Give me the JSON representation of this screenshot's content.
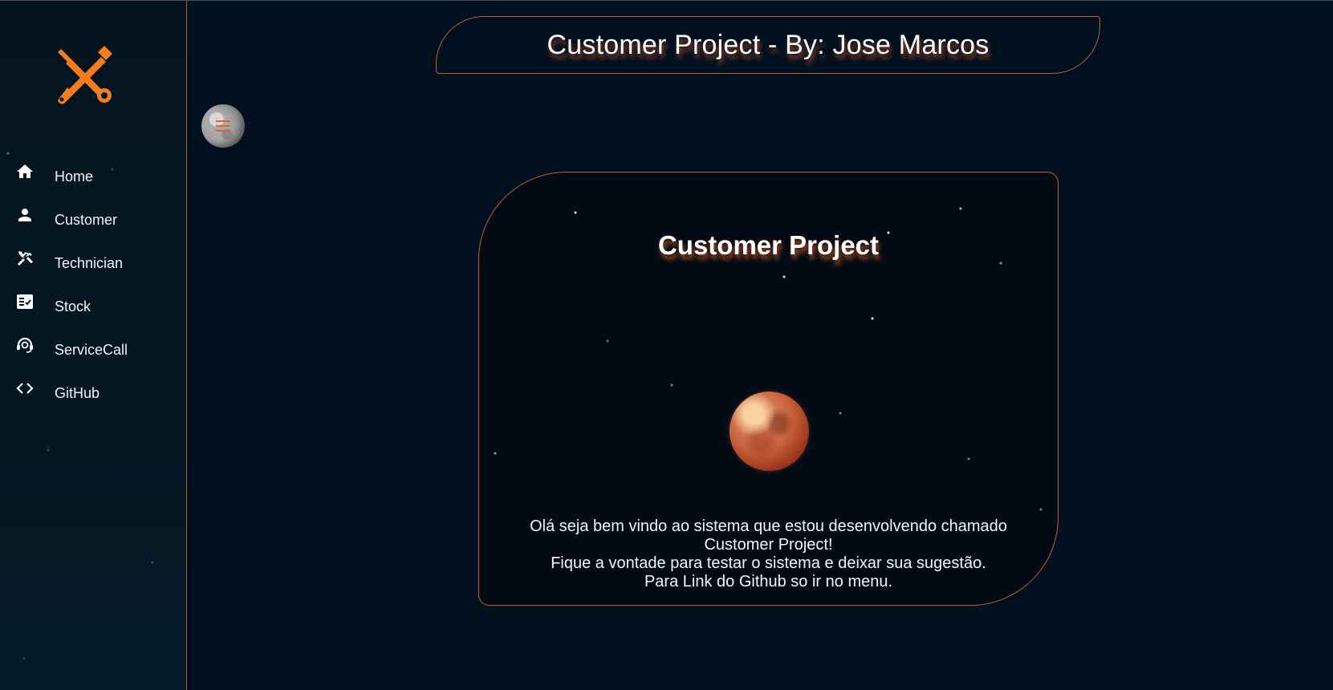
{
  "colors": {
    "background": "#01101f",
    "accent": "#c45b33",
    "logo": "#f47c1e",
    "text": "#ffffff"
  },
  "header": {
    "title": "Customer Project - By: Jose Marcos"
  },
  "logo": {
    "icon": "tools-icon"
  },
  "menu_toggle": {
    "icon": "hamburger-icon"
  },
  "sidebar": {
    "items": [
      {
        "label": "Home",
        "icon": "home-icon"
      },
      {
        "label": "Customer",
        "icon": "person-icon"
      },
      {
        "label": "Technician",
        "icon": "tools-icon"
      },
      {
        "label": "Stock",
        "icon": "checklist-icon"
      },
      {
        "label": "ServiceCall",
        "icon": "support-agent-icon"
      },
      {
        "label": "GitHub",
        "icon": "code-icon"
      }
    ]
  },
  "card": {
    "title": "Customer Project",
    "text_lines": [
      "Olá seja bem vindo ao sistema que estou desenvolvendo chamado",
      "Customer Project!",
      "Fique a vontade para testar o sistema e deixar sua sugestão.",
      "Para Link do Github so ir no menu."
    ]
  }
}
